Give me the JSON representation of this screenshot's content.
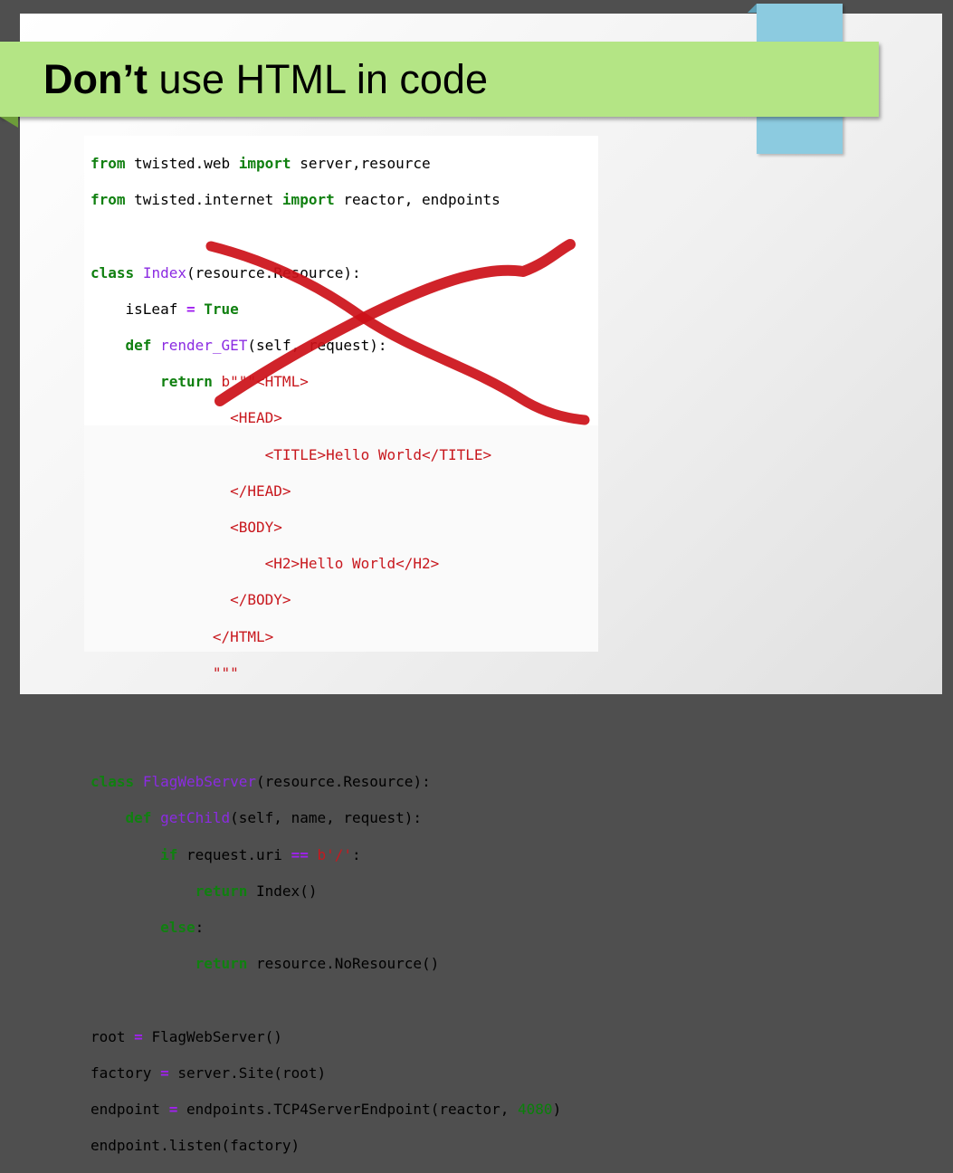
{
  "slide": {
    "title_bold": "Don’t",
    "title_rest": " use HTML in code"
  },
  "colors": {
    "title_bar": "#b4e585",
    "accent_tab": "#8ccbe0",
    "cross_mark": "#cc1018",
    "keyword": "#108010",
    "string": "#c8181e",
    "class_name": "#8b2be2"
  },
  "code": {
    "l1": {
      "a": "from",
      "b": " twisted.web ",
      "c": "import",
      "d": " server,resource"
    },
    "l2": {
      "a": "from",
      "b": " twisted.internet ",
      "c": "import",
      "d": " reactor, endpoints"
    },
    "l4": {
      "a": "class",
      "b": " ",
      "c": "Index",
      "d": "(resource.Resource):"
    },
    "l5": {
      "a": "    isLeaf ",
      "b": "=",
      "c": " ",
      "d": "True"
    },
    "l6": {
      "a": "    ",
      "b": "def",
      "c": " ",
      "d": "render_GET",
      "e": "(self, request):"
    },
    "l7": {
      "a": "        ",
      "b": "return",
      "c": " ",
      "d": "b\"\"\"<HTML>"
    },
    "l8": "                <HEAD>",
    "l9": "                    <TITLE>Hello World</TITLE>",
    "l10": "                </HEAD>",
    "l11": "                <BODY>",
    "l12": "                    <H2>Hello World</H2>",
    "l13": "                </BODY>",
    "l14": "              </HTML>",
    "l15": "              \"\"\"",
    "l18": {
      "a": "class",
      "b": " ",
      "c": "FlagWebServer",
      "d": "(resource.Resource):"
    },
    "l19": {
      "a": "    ",
      "b": "def",
      "c": " ",
      "d": "getChild",
      "e": "(self, name, request):"
    },
    "l20": {
      "a": "        ",
      "b": "if",
      "c": " request.uri ",
      "d": "==",
      "e": " ",
      "f": "b'/'",
      ":": ":"
    },
    "l21": {
      "a": "            ",
      "b": "return",
      "c": " Index()"
    },
    "l22": {
      "a": "        ",
      "b": "else",
      ":": ":"
    },
    "l23": {
      "a": "            ",
      "b": "return",
      "c": " resource.NoResource()"
    },
    "l25": {
      "a": "root ",
      "b": "=",
      "c": " FlagWebServer()"
    },
    "l26": {
      "a": "factory ",
      "b": "=",
      "c": " server.Site(root)"
    },
    "l27": {
      "a": "endpoint ",
      "b": "=",
      "c": " endpoints.TCP4ServerEndpoint(reactor, ",
      "d": "4080",
      ")": ")"
    },
    "l28": "endpoint.listen(factory)"
  }
}
